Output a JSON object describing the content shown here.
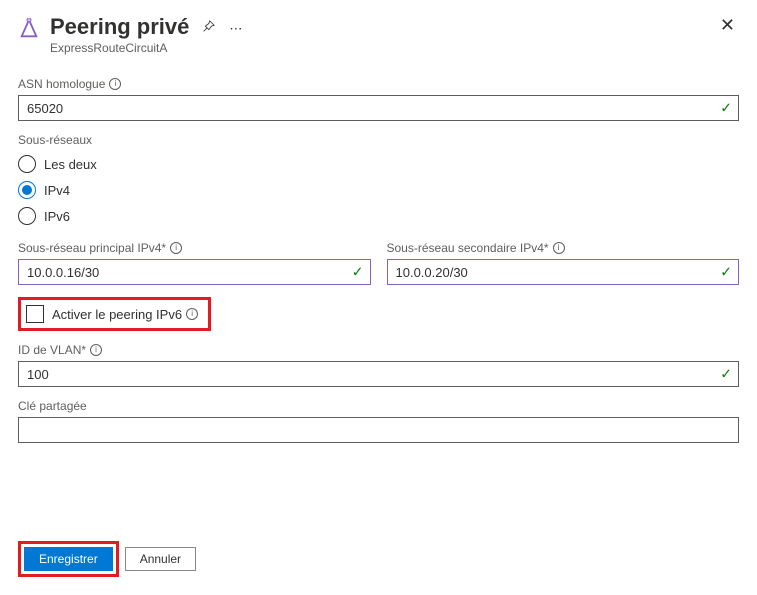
{
  "header": {
    "title": "Peering privé",
    "subtitle": "ExpressRouteCircuitA"
  },
  "asn": {
    "label": "ASN homologue",
    "value": "65020"
  },
  "subnets": {
    "label": "Sous-réseaux",
    "options": {
      "both": "Les deux",
      "ipv4": "IPv4",
      "ipv6": "IPv6"
    },
    "selected": "ipv4"
  },
  "primary": {
    "label": "Sous-réseau principal IPv4*",
    "value": "10.0.0.16/30"
  },
  "secondary": {
    "label": "Sous-réseau secondaire IPv4*",
    "value": "10.0.0.20/30"
  },
  "enablePeering": {
    "label": "Activer le peering IPv6"
  },
  "vlan": {
    "label": "ID de VLAN*",
    "value": "100"
  },
  "sharedKey": {
    "label": "Clé partagée",
    "value": ""
  },
  "buttons": {
    "save": "Enregistrer",
    "cancel": "Annuler"
  }
}
